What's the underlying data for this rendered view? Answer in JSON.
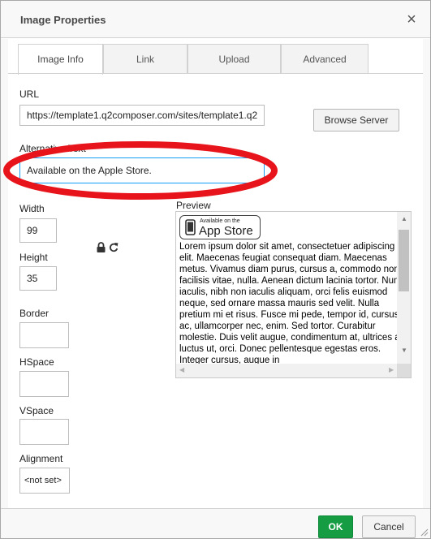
{
  "dialog": {
    "title": "Image Properties",
    "close_glyph": "×"
  },
  "tabs": [
    {
      "label": "Image Info",
      "active": true
    },
    {
      "label": "Link",
      "active": false
    },
    {
      "label": "Upload",
      "active": false
    },
    {
      "label": "Advanced",
      "active": false
    }
  ],
  "form": {
    "url_label": "URL",
    "url_value": "https://template1.q2composer.com/sites/template1.q2",
    "browse_server_label": "Browse Server",
    "alt_text_label": "Alternative Text",
    "alt_text_value": "Available on the Apple Store.",
    "width_label": "Width",
    "width_value": "99",
    "height_label": "Height",
    "height_value": "35",
    "border_label": "Border",
    "border_value": "",
    "hspace_label": "HSpace",
    "hspace_value": "",
    "vspace_label": "VSpace",
    "vspace_value": "",
    "alignment_label": "Alignment",
    "alignment_value": "<not set>",
    "lock_icon": "lock-icon",
    "reset_icon": "reset-size-icon"
  },
  "preview": {
    "label": "Preview",
    "badge_small_text": "Available on the",
    "badge_big_text": "App Store",
    "lorem": "Lorem ipsum dolor sit amet, consectetuer adipiscing elit. Maecenas feugiat consequat diam. Maecenas metus. Vivamus diam purus, cursus a, commodo non, facilisis vitae, nulla. Aenean dictum lacinia tortor. Nunc iaculis, nibh non iaculis aliquam, orci felis euismod neque, sed ornare massa mauris sed velit. Nulla pretium mi et risus. Fusce mi pede, tempor id, cursus ac, ullamcorper nec, enim. Sed tortor. Curabitur molestie. Duis velit augue, condimentum at, ultrices a, luctus ut, orci. Donec pellentesque egestas eros. Integer cursus, augue in"
  },
  "footer": {
    "ok_label": "OK",
    "cancel_label": "Cancel"
  },
  "colors": {
    "ok_green": "#169c43",
    "focus_blue": "#139ff7",
    "annotation_red": "#e8141b"
  }
}
